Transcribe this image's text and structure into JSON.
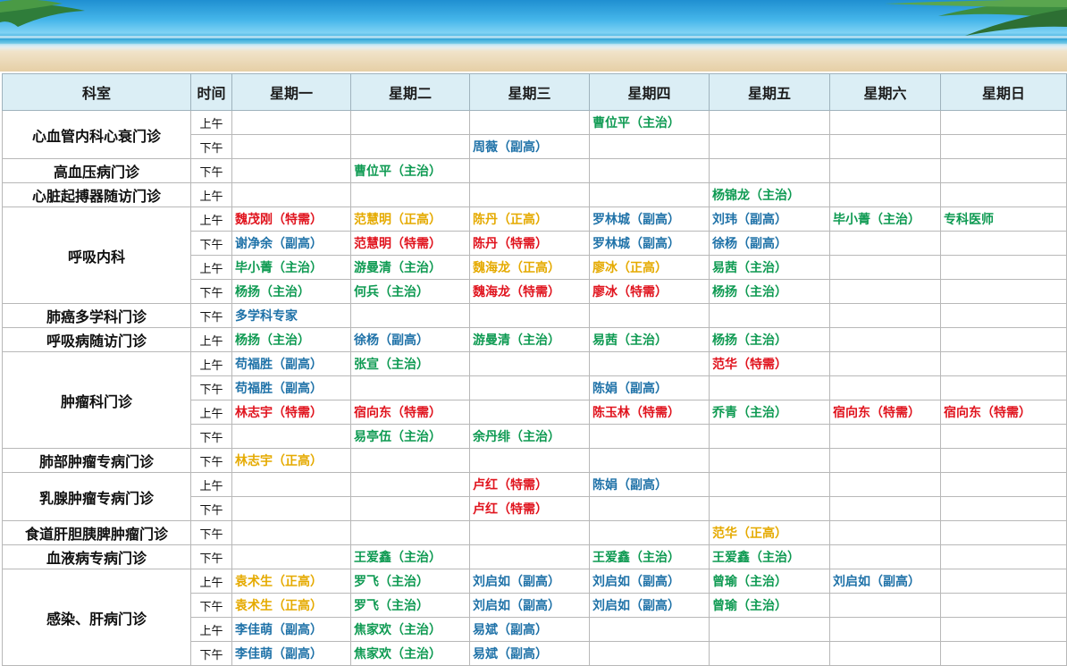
{
  "header": [
    "科室",
    "时间",
    "星期一",
    "星期二",
    "星期三",
    "星期四",
    "星期五",
    "星期六",
    "星期日"
  ],
  "colors": {
    "green": "#0e9a52",
    "blue": "#1f72a8",
    "red": "#e0141e",
    "gold": "#e5aa00",
    "header_bg": "#dbeef5"
  },
  "departments": [
    {
      "name": "心血管内科心衰门诊",
      "rows": [
        {
          "time": "上午",
          "cells": [
            "",
            "",
            "",
            {
              "t": "曹位平（主治）",
              "c": "green"
            },
            "",
            "",
            ""
          ]
        },
        {
          "time": "下午",
          "cells": [
            "",
            "",
            {
              "t": "周薇（副高）",
              "c": "blue"
            },
            "",
            "",
            "",
            ""
          ]
        }
      ]
    },
    {
      "name": "高血压病门诊",
      "rows": [
        {
          "time": "下午",
          "cells": [
            "",
            {
              "t": "曹位平（主治）",
              "c": "green"
            },
            "",
            "",
            "",
            "",
            ""
          ]
        }
      ]
    },
    {
      "name": "心脏起搏器随访门诊",
      "rows": [
        {
          "time": "上午",
          "cells": [
            "",
            "",
            "",
            "",
            {
              "t": "杨锦龙（主治）",
              "c": "green"
            },
            "",
            ""
          ]
        }
      ]
    },
    {
      "name": "呼吸内科",
      "rows": [
        {
          "time": "上午",
          "cells": [
            {
              "t": "魏茂刚（特需）",
              "c": "red"
            },
            {
              "t": "范慧明（正高）",
              "c": "gold"
            },
            {
              "t": "陈丹（正高）",
              "c": "gold"
            },
            {
              "t": "罗林城（副高）",
              "c": "blue"
            },
            {
              "t": "刘玮（副高）",
              "c": "blue"
            },
            {
              "t": "毕小菁（主治）",
              "c": "green"
            },
            {
              "t": "专科医师",
              "c": "green"
            }
          ]
        },
        {
          "time": "下午",
          "cells": [
            {
              "t": "谢净余（副高）",
              "c": "blue"
            },
            {
              "t": "范慧明（特需）",
              "c": "red"
            },
            {
              "t": "陈丹（特需）",
              "c": "red"
            },
            {
              "t": "罗林城（副高）",
              "c": "blue"
            },
            {
              "t": "徐杨（副高）",
              "c": "blue"
            },
            "",
            ""
          ]
        },
        {
          "time": "上午",
          "cells": [
            {
              "t": "毕小菁（主治）",
              "c": "green"
            },
            {
              "t": "游曼清（主治）",
              "c": "green"
            },
            {
              "t": "魏海龙（正高）",
              "c": "gold"
            },
            {
              "t": "廖冰（正高）",
              "c": "gold"
            },
            {
              "t": "易茜（主治）",
              "c": "green"
            },
            "",
            ""
          ]
        },
        {
          "time": "下午",
          "cells": [
            {
              "t": "杨扬（主治）",
              "c": "green"
            },
            {
              "t": "何兵（主治）",
              "c": "green"
            },
            {
              "t": "魏海龙（特需）",
              "c": "red"
            },
            {
              "t": "廖冰（特需）",
              "c": "red"
            },
            {
              "t": "杨扬（主治）",
              "c": "green"
            },
            "",
            ""
          ]
        }
      ]
    },
    {
      "name": "肺癌多学科门诊",
      "rows": [
        {
          "time": "下午",
          "cells": [
            {
              "t": "多学科专家",
              "c": "blue"
            },
            "",
            "",
            "",
            "",
            "",
            ""
          ]
        }
      ]
    },
    {
      "name": "呼吸病随访门诊",
      "rows": [
        {
          "time": "上午",
          "cells": [
            {
              "t": "杨扬（主治）",
              "c": "green"
            },
            {
              "t": "徐杨（副高）",
              "c": "blue"
            },
            {
              "t": "游曼清（主治）",
              "c": "green"
            },
            {
              "t": "易茜（主治）",
              "c": "green"
            },
            {
              "t": "杨扬（主治）",
              "c": "green"
            },
            "",
            ""
          ]
        }
      ]
    },
    {
      "name": "肿瘤科门诊",
      "rows": [
        {
          "time": "上午",
          "cells": [
            {
              "t": "苟福胜（副高）",
              "c": "blue"
            },
            {
              "t": "张宣（主治）",
              "c": "green"
            },
            "",
            "",
            {
              "t": "范华（特需）",
              "c": "red"
            },
            "",
            ""
          ]
        },
        {
          "time": "下午",
          "cells": [
            {
              "t": "苟福胜（副高）",
              "c": "blue"
            },
            "",
            "",
            {
              "t": "陈娟（副高）",
              "c": "blue"
            },
            "",
            "",
            ""
          ]
        },
        {
          "time": "上午",
          "cells": [
            {
              "t": "林志宇（特需）",
              "c": "red"
            },
            {
              "t": "宿向东（特需）",
              "c": "red"
            },
            "",
            {
              "t": "陈玉林（特需）",
              "c": "red"
            },
            {
              "t": "乔青（主治）",
              "c": "green"
            },
            {
              "t": "宿向东（特需）",
              "c": "red"
            },
            {
              "t": "宿向东（特需）",
              "c": "red"
            }
          ]
        },
        {
          "time": "下午",
          "cells": [
            "",
            {
              "t": "易亭伍（主治）",
              "c": "green"
            },
            {
              "t": "余丹绯（主治）",
              "c": "green"
            },
            "",
            "",
            "",
            ""
          ]
        }
      ]
    },
    {
      "name": "肺部肿瘤专病门诊",
      "rows": [
        {
          "time": "下午",
          "cells": [
            {
              "t": "林志宇（正高）",
              "c": "gold"
            },
            "",
            "",
            "",
            "",
            "",
            ""
          ]
        }
      ]
    },
    {
      "name": "乳腺肿瘤专病门诊",
      "rows": [
        {
          "time": "上午",
          "cells": [
            "",
            "",
            {
              "t": "卢红（特需）",
              "c": "red"
            },
            {
              "t": "陈娟（副高）",
              "c": "blue"
            },
            "",
            "",
            ""
          ]
        },
        {
          "time": "下午",
          "cells": [
            "",
            "",
            {
              "t": "卢红（特需）",
              "c": "red"
            },
            "",
            "",
            "",
            ""
          ]
        }
      ]
    },
    {
      "name": "食道肝胆胰脾肿瘤门诊",
      "rows": [
        {
          "time": "下午",
          "cells": [
            "",
            "",
            "",
            "",
            {
              "t": "范华（正高）",
              "c": "gold"
            },
            "",
            ""
          ]
        }
      ]
    },
    {
      "name": "血液病专病门诊",
      "rows": [
        {
          "time": "下午",
          "cells": [
            "",
            {
              "t": "王爱鑫（主治）",
              "c": "green"
            },
            "",
            {
              "t": "王爱鑫（主治）",
              "c": "green"
            },
            {
              "t": "王爱鑫（主治）",
              "c": "green"
            },
            "",
            ""
          ]
        }
      ]
    },
    {
      "name": "感染、肝病门诊",
      "rows": [
        {
          "time": "上午",
          "cells": [
            {
              "t": "袁术生（正高）",
              "c": "gold"
            },
            {
              "t": "罗飞（主治）",
              "c": "green"
            },
            {
              "t": "刘启如（副高）",
              "c": "blue"
            },
            {
              "t": "刘启如（副高）",
              "c": "blue"
            },
            {
              "t": "曾瑜（主治）",
              "c": "green"
            },
            {
              "t": "刘启如（副高）",
              "c": "blue"
            },
            ""
          ]
        },
        {
          "time": "下午",
          "cells": [
            {
              "t": "袁术生（正高）",
              "c": "gold"
            },
            {
              "t": "罗飞（主治）",
              "c": "green"
            },
            {
              "t": "刘启如（副高）",
              "c": "blue"
            },
            {
              "t": "刘启如（副高）",
              "c": "blue"
            },
            {
              "t": "曾瑜（主治）",
              "c": "green"
            },
            "",
            ""
          ]
        },
        {
          "time": "上午",
          "cells": [
            {
              "t": "李佳萌（副高）",
              "c": "blue"
            },
            {
              "t": "焦家欢（主治）",
              "c": "green"
            },
            {
              "t": "易斌（副高）",
              "c": "blue"
            },
            "",
            "",
            "",
            ""
          ]
        },
        {
          "time": "下午",
          "cells": [
            {
              "t": "李佳萌（副高）",
              "c": "blue"
            },
            {
              "t": "焦家欢（主治）",
              "c": "green"
            },
            {
              "t": "易斌（副高）",
              "c": "blue"
            },
            "",
            "",
            "",
            ""
          ]
        }
      ]
    }
  ]
}
